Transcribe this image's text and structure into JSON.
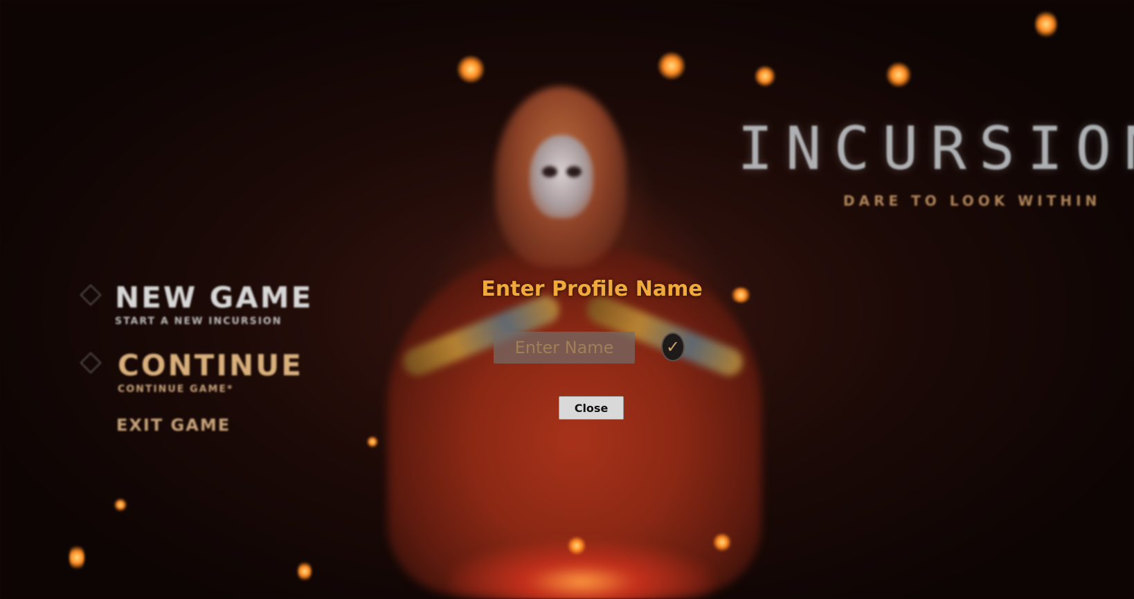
{
  "background": {
    "logo_text": "INCURSION",
    "tagline": "DARE TO LOOK WITHIN",
    "accent_color": "#f0a93a"
  },
  "menu": {
    "new_game": {
      "title": "NEW GAME",
      "subtitle": "START A NEW INCURSION",
      "icon": "diamond-icon"
    },
    "continue": {
      "title": "CONTINUE",
      "subtitle": "CONTINUE GAME*",
      "icon": "diamond-icon"
    },
    "exit": {
      "title": "EXIT GAME"
    }
  },
  "dialog": {
    "title": "Enter Profile Name",
    "input_placeholder": "Enter Name",
    "input_value": "",
    "confirm_icon": "checkmark-icon",
    "confirm_glyph": "✓",
    "close_label": "Close"
  }
}
